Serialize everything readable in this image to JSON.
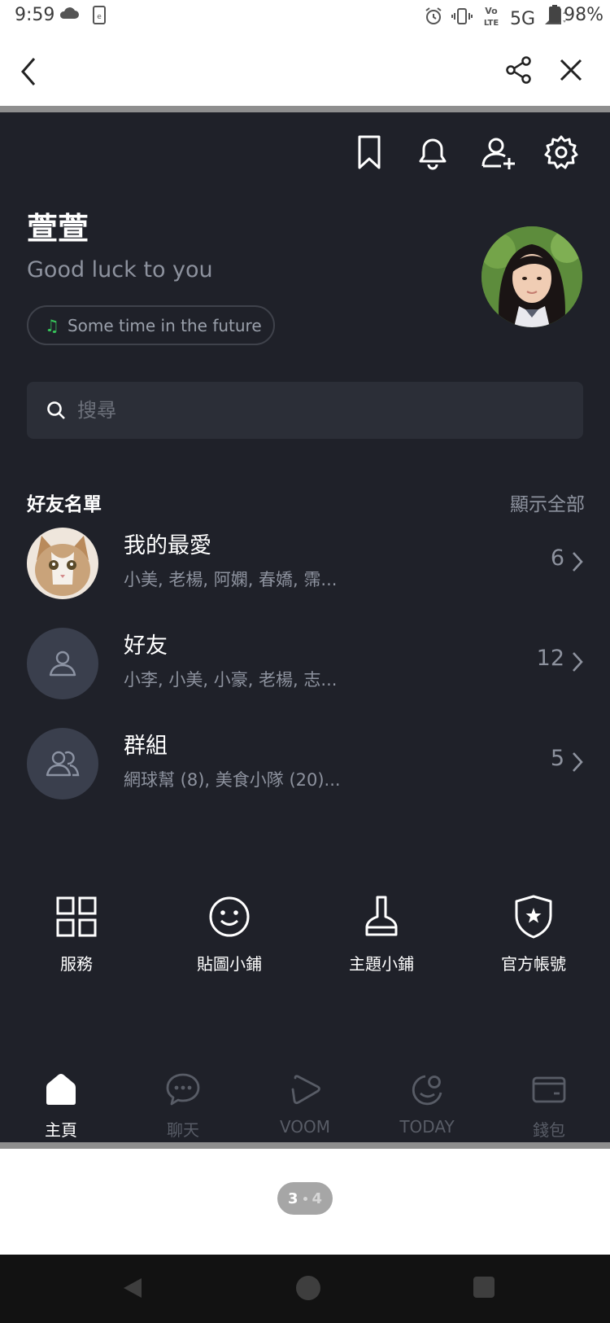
{
  "status_bar": {
    "time": "9:59",
    "network": "5G",
    "volte": "Vo LTE",
    "battery": "98%",
    "icons": [
      "cloud-icon",
      "sim-icon",
      "alarm-icon",
      "vibrate-icon",
      "volte-icon",
      "signal-icon",
      "battery-icon"
    ]
  },
  "top_nav": {
    "icons": [
      "back-arrow-icon",
      "share-icon",
      "close-icon"
    ]
  },
  "header_icons": [
    "bookmark-icon",
    "bell-icon",
    "add-friend-icon",
    "gear-icon"
  ],
  "profile": {
    "name": "萱萱",
    "status_message": "Good luck to you",
    "music": "Some time in the future"
  },
  "search": {
    "placeholder": "搜尋"
  },
  "friends_section": {
    "title": "好友名單",
    "show_all": "顯示全部",
    "rows": [
      {
        "title": "我的最愛",
        "subtitle": "小美, 老楊, 阿嫻, 春嬌, 霈...",
        "count": "6",
        "avatar": "cat-photo"
      },
      {
        "title": "好友",
        "subtitle": "小李, 小美, 小豪, 老楊, 志...",
        "count": "12",
        "avatar": "person-icon"
      },
      {
        "title": "群組",
        "subtitle": "網球幫 (8), 美食小隊 (20)...",
        "count": "5",
        "avatar": "group-icon"
      }
    ]
  },
  "quick_actions": [
    {
      "label": "服務",
      "icon": "grid-icon"
    },
    {
      "label": "貼圖小鋪",
      "icon": "smiley-icon"
    },
    {
      "label": "主題小鋪",
      "icon": "brush-icon"
    },
    {
      "label": "官方帳號",
      "icon": "shield-star-icon"
    }
  ],
  "bottom_tabs": [
    {
      "label": "主頁",
      "icon": "home-icon",
      "active": true
    },
    {
      "label": "聊天",
      "icon": "chat-icon",
      "active": false
    },
    {
      "label": "VOOM",
      "icon": "voom-icon",
      "active": false
    },
    {
      "label": "TODAY",
      "icon": "today-icon",
      "active": false
    },
    {
      "label": "錢包",
      "icon": "wallet-icon",
      "active": false
    }
  ],
  "page_indicator": {
    "current": "3",
    "total": "4"
  },
  "colors": {
    "background": "#1f2129",
    "search_bg": "#2b2e37",
    "muted_text": "#8d929e",
    "music_note": "#36c55a",
    "inactive_tab": "#585c66"
  }
}
